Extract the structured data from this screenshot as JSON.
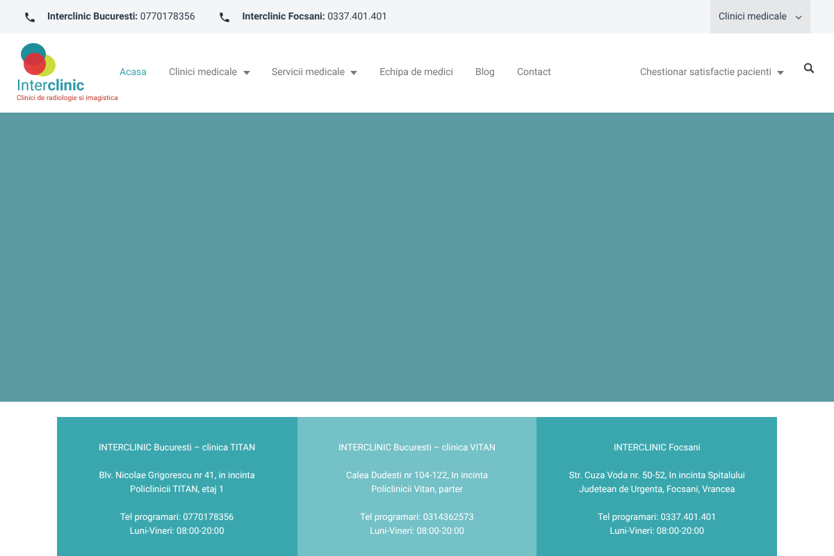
{
  "top_bar": {
    "contacts": [
      "**Interclinic Bucuresti:** 0770178356",
      "**Interclinic Focsani:** 0337.401.401"
    ],
    "clinic_select": {
      "value": "Clinici medicale"
    }
  },
  "logo": {
    "name": "Inter**clinic**",
    "tagline": "Clinici de radiologie si imagistica"
  },
  "nav": [
    {
      "label": "Acasa",
      "selected": true,
      "dropdown": false
    },
    {
      "label": "Clinici medicale",
      "selected": false,
      "dropdown": true
    },
    {
      "label": "Servicii medicale",
      "selected": false,
      "dropdown": true
    },
    {
      "label": "Echipa de medici",
      "selected": false,
      "dropdown": false
    },
    {
      "label": "Blog",
      "selected": false,
      "dropdown": false
    },
    {
      "label": "Contact",
      "selected": false,
      "dropdown": false
    }
  ],
  "nav_right": {
    "label": "Chestionar satisfactie pacienti",
    "dropdown": true
  },
  "clinics": [
    {
      "title": "INTERCLINIC Bucuresti – clinica TITAN",
      "address": "Blv. Nicolae Grigorescu nr 41, in incinta Policlinicii TITAN, etaj 1",
      "phone": "Tel programari: 0770178356",
      "hours": "Luni-Vineri: 08:00-20:00",
      "color": "#3aa7ae"
    },
    {
      "title": "INTERCLINIC Bucuresti – clinica VITAN",
      "address": "Calea Dudesti nr 104-122, In incinta Policlinicii Vitan, parter",
      "phone": "Tel programari: 0314362573",
      "hours": "Luni-Vineri: 08:00-20:00",
      "color": "#74c1c7"
    },
    {
      "title": "INTERCLINIC Focsani",
      "address": "Str. Cuza Voda nr. 50-52, In incinta Spitalului Judetean de Urgenta, Focsani, Vrancea",
      "phone": "Tel programari: 0337.401.401",
      "hours": "Luni-Vineri: 08:00-20:00",
      "color": "#3aa7ae"
    }
  ]
}
